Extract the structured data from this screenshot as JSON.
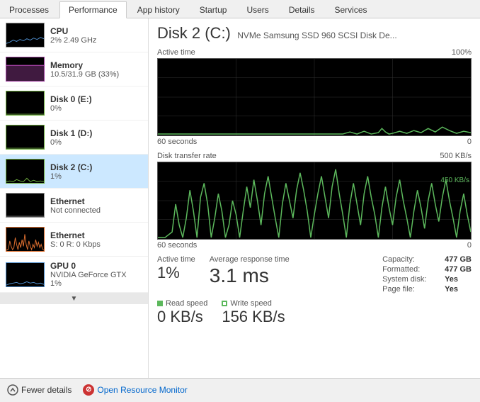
{
  "tabs": [
    {
      "label": "Processes",
      "active": false
    },
    {
      "label": "Performance",
      "active": true
    },
    {
      "label": "App history",
      "active": false
    },
    {
      "label": "Startup",
      "active": false
    },
    {
      "label": "Users",
      "active": false
    },
    {
      "label": "Details",
      "active": false
    },
    {
      "label": "Services",
      "active": false
    }
  ],
  "sidebar": {
    "items": [
      {
        "name": "CPU",
        "value": "2% 2.49 GHz",
        "graph_type": "cpu"
      },
      {
        "name": "Memory",
        "value": "10.5/31.9 GB (33%)",
        "graph_type": "memory"
      },
      {
        "name": "Disk 0 (E:)",
        "value": "0%",
        "graph_type": "disk0"
      },
      {
        "name": "Disk 1 (D:)",
        "value": "0%",
        "graph_type": "disk1"
      },
      {
        "name": "Disk 2 (C:)",
        "value": "1%",
        "graph_type": "disk2",
        "active": true
      },
      {
        "name": "Ethernet",
        "value": "Not connected",
        "graph_type": "eth1"
      },
      {
        "name": "Ethernet",
        "value": "S: 0 R: 0 Kbps",
        "graph_type": "eth2"
      },
      {
        "name": "GPU 0",
        "value": "NVIDIA GeForce GTX\n1%",
        "graph_type": "gpu"
      }
    ]
  },
  "main": {
    "disk_title": "Disk 2 (C:)",
    "disk_subtitle": "NVMe Samsung SSD 960 SCSI Disk De...",
    "chart1": {
      "label_left": "Active time",
      "label_right": "100%",
      "time_label": "60 seconds",
      "value_label": "0"
    },
    "chart2": {
      "label_left": "Disk transfer rate",
      "label_right": "500 KB/s",
      "time_label": "60 seconds",
      "value_label": "0",
      "alt_right": "450 KB/s"
    },
    "stats": {
      "active_time_label": "Active time",
      "active_time_value": "1%",
      "response_time_label": "Average response time",
      "response_time_value": "3.1 ms",
      "capacity_label": "Capacity:",
      "capacity_value": "477 GB",
      "formatted_label": "Formatted:",
      "formatted_value": "477 GB",
      "system_disk_label": "System disk:",
      "system_disk_value": "Yes",
      "page_file_label": "Page file:",
      "page_file_value": "Yes"
    },
    "speeds": {
      "read_label": "Read speed",
      "read_value": "0 KB/s",
      "write_label": "Write speed",
      "write_value": "156 KB/s"
    }
  },
  "footer": {
    "fewer_details_label": "Fewer details",
    "monitor_label": "Open Resource Monitor"
  }
}
